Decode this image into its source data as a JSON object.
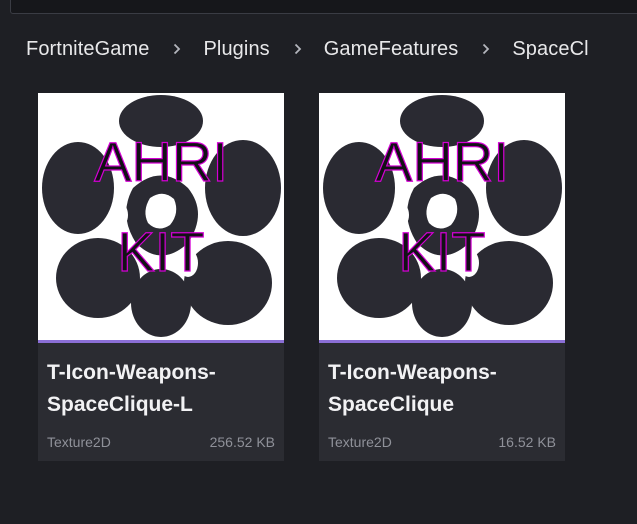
{
  "search": {
    "value": ""
  },
  "breadcrumb": {
    "items": [
      "FortniteGame",
      "Plugins",
      "GameFeatures",
      "SpaceCl"
    ],
    "separator_icon": "chevron-right-icon"
  },
  "assets": [
    {
      "thumbnail_text": [
        "AHRI",
        "KIT"
      ],
      "name_line1": "T-Icon-Weapons-",
      "name_line2": "SpaceClique-L",
      "type": "Texture2D",
      "size": "256.52 KB"
    },
    {
      "thumbnail_text": [
        "AHRI",
        "KIT"
      ],
      "name_line1": "T-Icon-Weapons-",
      "name_line2": "SpaceClique",
      "type": "Texture2D",
      "size": "16.52 KB"
    }
  ],
  "colors": {
    "background": "#1e1f24",
    "tile": "#2b2c32",
    "accent": "#8b6fd6",
    "thumb_text_stroke": "#d400d4"
  }
}
